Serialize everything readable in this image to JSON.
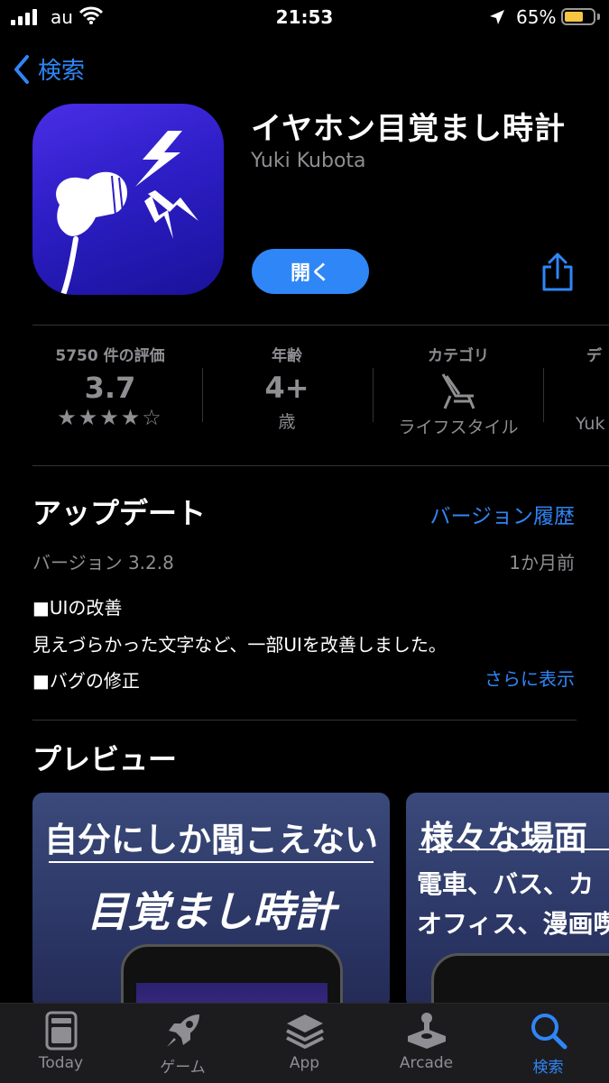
{
  "status_bar": {
    "carrier": "au",
    "time": "21:53",
    "battery_percent": "65%",
    "battery_level": 0.65,
    "battery_color": "#f5c543"
  },
  "nav": {
    "back_label": "検索"
  },
  "app": {
    "name": "イヤホン目覚まし時計",
    "developer": "Yuki Kubota",
    "open_label": "開く",
    "accent": "#2f86f6"
  },
  "info": {
    "ratings": {
      "label": "5750 件の評価",
      "value": "3.7",
      "stars": "★★★★☆",
      "star_level": 3.7
    },
    "age": {
      "label": "年齢",
      "value": "4+",
      "sub": "歳"
    },
    "category": {
      "label": "カテゴリ",
      "icon": "beach-chair-icon",
      "sub": "ライフスタイル"
    },
    "developer": {
      "label": "デ",
      "sub": "Yuk"
    }
  },
  "update": {
    "title": "アップデート",
    "history_link": "バージョン履歴",
    "version": "バージョン 3.2.8",
    "ago": "1か月前",
    "note_line1": "■UIの改善",
    "note_line2": "見えづらかった文字など、一部UIを改善しました。",
    "note_line3": "■バグの修正",
    "more_link": "さらに表示"
  },
  "preview": {
    "title": "プレビュー",
    "card1": {
      "line1": "自分にしか聞こえない",
      "line2": "目覚まし時計"
    },
    "card2": {
      "line1": "様々な場面",
      "line2": "電車、バス、カ",
      "line3": "オフィス、漫画喫"
    }
  },
  "tabs": [
    {
      "label": "Today",
      "icon": "today-icon"
    },
    {
      "label": "ゲーム",
      "icon": "rocket-icon"
    },
    {
      "label": "App",
      "icon": "layers-icon"
    },
    {
      "label": "Arcade",
      "icon": "joystick-icon"
    },
    {
      "label": "検索",
      "icon": "search-icon"
    }
  ]
}
